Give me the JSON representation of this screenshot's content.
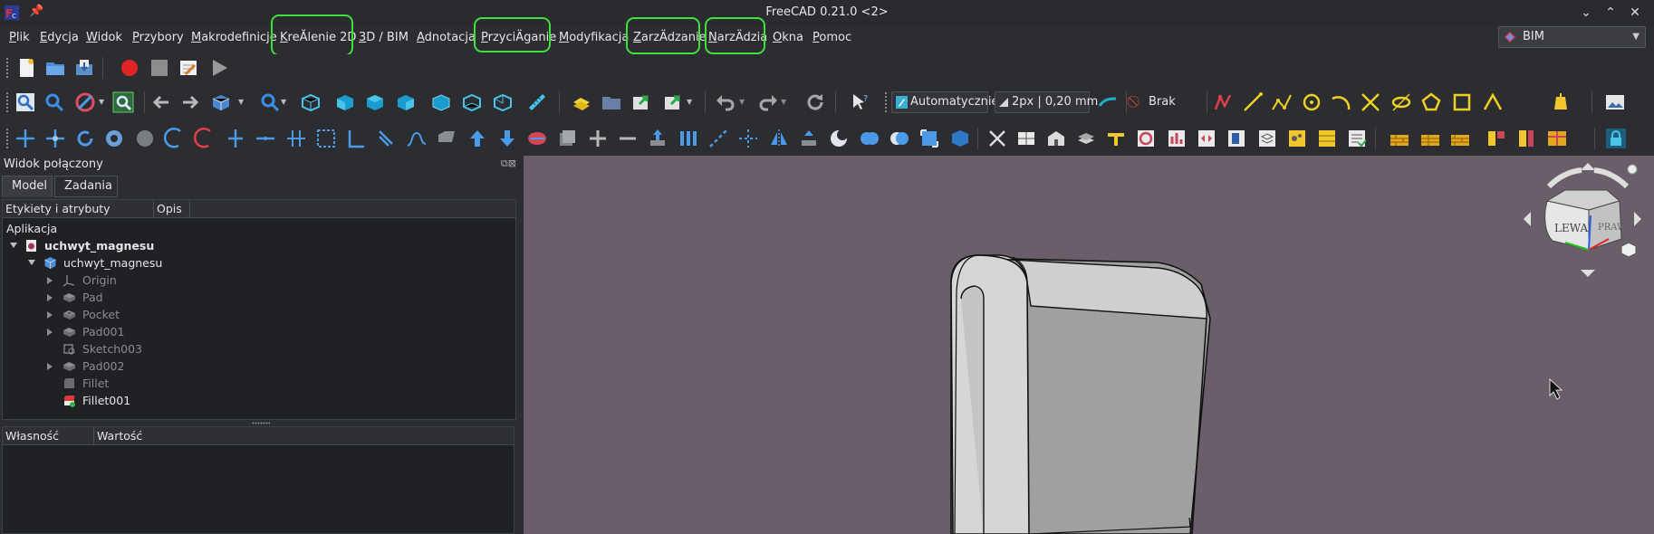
{
  "window": {
    "title": "FreeCAD 0.21.0 <2>",
    "controls": [
      "chevron-down",
      "chevron-up",
      "close"
    ]
  },
  "menu": {
    "items": [
      {
        "label": "Plik",
        "u": "P",
        "rest": "lik"
      },
      {
        "label": "Edycja",
        "u": "E",
        "rest": "dycja"
      },
      {
        "label": "Widok",
        "u": "W",
        "rest": "idok"
      },
      {
        "label": "Przybory",
        "u": "P",
        "rest": "rzybory"
      },
      {
        "label": "Makrodefinicje",
        "u": "M",
        "rest": "akrodefinicje"
      },
      {
        "label": "KreĂlenie 2D",
        "u": "K",
        "rest": "reĂlenie 2D"
      },
      {
        "label": "3D / BIM",
        "u": "3",
        "rest": "D / BIM"
      },
      {
        "label": "Adnotacja",
        "u": "A",
        "rest": "dnotacja"
      },
      {
        "label": "PrzyciÄganie",
        "u": "P",
        "rest": "rzyciÄganie"
      },
      {
        "label": "Modyfikacja",
        "u": "M",
        "rest": "odyfikacja"
      },
      {
        "label": "ZarzÄdzanie",
        "u": "Z",
        "rest": "arzÄdzanie"
      },
      {
        "label": "NarzÄdzia",
        "u": "N",
        "rest": "arzÄdzia"
      },
      {
        "label": "Okna",
        "u": "O",
        "rest": "kna"
      },
      {
        "label": "Pomoc",
        "u": "P",
        "rest": "omoc"
      }
    ],
    "highlight_color": "#3fe03c"
  },
  "workbench": {
    "selected": "BIM"
  },
  "toolbar3": {
    "draw_style": "Automatycznie",
    "line_width": "2px | 0,20 mm",
    "snap_mode": "Brak"
  },
  "combo_view": {
    "title": "Widok połączony",
    "tabs": [
      "Model",
      "Zadania"
    ],
    "active_tab": "Model",
    "tree_headers": [
      "Etykiety i atrybuty",
      "Opis"
    ],
    "tree_root": "Aplikacja",
    "tree_items": [
      {
        "label": "uchwyt_magnesu",
        "level": 0,
        "expander": "down",
        "bold": true,
        "dim": false,
        "icon": "document"
      },
      {
        "label": "uchwyt_magnesu",
        "level": 1,
        "expander": "down",
        "bold": false,
        "dim": false,
        "icon": "body"
      },
      {
        "label": "Origin",
        "level": 2,
        "expander": "right",
        "bold": false,
        "dim": true,
        "icon": "origin"
      },
      {
        "label": "Pad",
        "level": 2,
        "expander": "right",
        "bold": false,
        "dim": true,
        "icon": "pad"
      },
      {
        "label": "Pocket",
        "level": 2,
        "expander": "right",
        "bold": false,
        "dim": true,
        "icon": "pocket"
      },
      {
        "label": "Pad001",
        "level": 2,
        "expander": "right",
        "bold": false,
        "dim": true,
        "icon": "pad"
      },
      {
        "label": "Sketch003",
        "level": 2,
        "expander": "none",
        "bold": false,
        "dim": true,
        "icon": "sketch"
      },
      {
        "label": "Pad002",
        "level": 2,
        "expander": "right",
        "bold": false,
        "dim": true,
        "icon": "pad"
      },
      {
        "label": "Fillet",
        "level": 2,
        "expander": "none",
        "bold": false,
        "dim": true,
        "icon": "fillet"
      },
      {
        "label": "Fillet001",
        "level": 2,
        "expander": "none",
        "bold": false,
        "dim": false,
        "icon": "fillet-active"
      }
    ],
    "property_headers": [
      "Własność",
      "Wartość"
    ]
  },
  "navcube": {
    "face_left": "LEWA",
    "face_right": "PRAW"
  },
  "colors": {
    "viewport_bg": "#6b5e6b",
    "model_light": "#d8d8d8",
    "model_dark": "#9c9c9c"
  }
}
